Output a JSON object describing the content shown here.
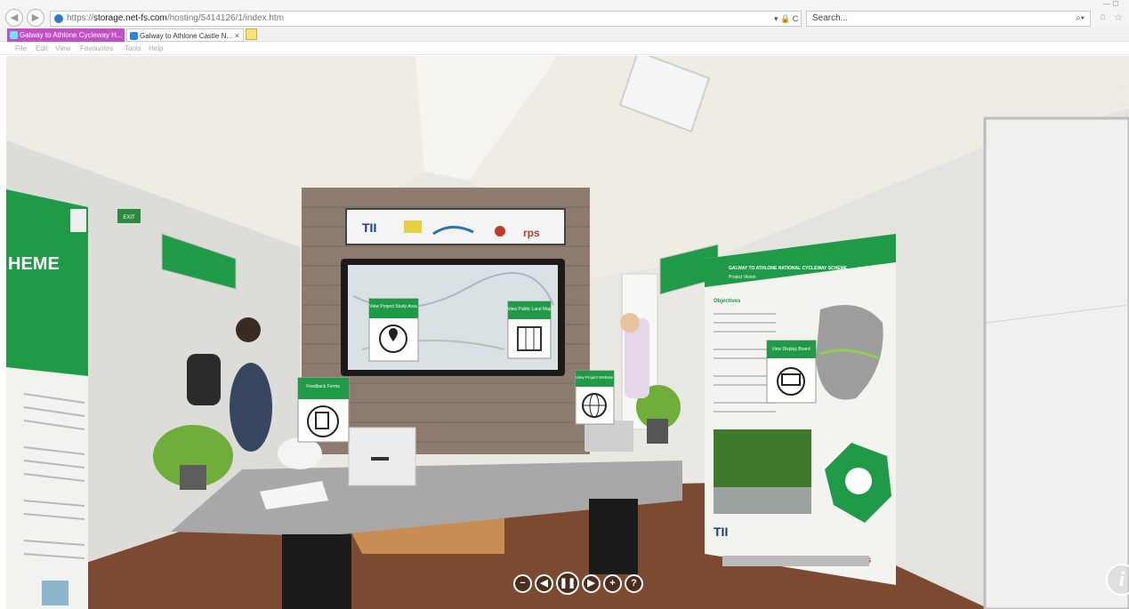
{
  "browser": {
    "url_prefix": "https://",
    "url_host": "storage.net-fs.com",
    "url_path": "/hosting/5414126/1/index.htm",
    "url_tools": "▾ 🔒 C",
    "search_placeholder": "Search...",
    "search_icon": "⌕▾",
    "window_controls": "—  ☐",
    "tabs": [
      {
        "label": "Galway to Athlone Cycleway H..."
      },
      {
        "label": "Galway to Athlone Castle N..."
      }
    ],
    "tab_close": "×",
    "menu": [
      "File",
      "Edit",
      "View",
      "Favourites",
      "Tools",
      "Help"
    ]
  },
  "scene": {
    "left_banner_heading": "HEME",
    "exit_sign": "EXIT",
    "screen_buttons": [
      {
        "label": "View Project Study Area",
        "icon": "location-pin-icon"
      },
      {
        "label": "View Public Land Map",
        "icon": "map-icon"
      }
    ],
    "desk_buttons": [
      {
        "label": "Feedback Forms",
        "icon": "feedback-form-icon"
      },
      {
        "label": "View Project Website",
        "icon": "globe-icon"
      }
    ],
    "banner_button": {
      "label": "View Display Board",
      "icon": "display-board-icon"
    },
    "logos": [
      "TII",
      "rps"
    ],
    "right_banner_title": "GALWAY TO ATHLONE NATIONAL CYCLEWAY SCHEME",
    "right_banner_subtitle": "Project Vision",
    "right_banner_section": "Objectives"
  },
  "controls": [
    {
      "name": "zoom-out-button",
      "glyph": "−"
    },
    {
      "name": "pan-left-button",
      "glyph": "◀"
    },
    {
      "name": "pause-button",
      "glyph": "❚❚"
    },
    {
      "name": "pan-right-button",
      "glyph": "▶"
    },
    {
      "name": "zoom-in-button",
      "glyph": "+"
    },
    {
      "name": "help-button",
      "glyph": "?"
    }
  ],
  "info_glyph": "i",
  "colors": {
    "brand_green": "#1f9a46",
    "tab_active": "#c34fc6",
    "wall": "#e9e8e3",
    "floor": "#7b4a30"
  }
}
